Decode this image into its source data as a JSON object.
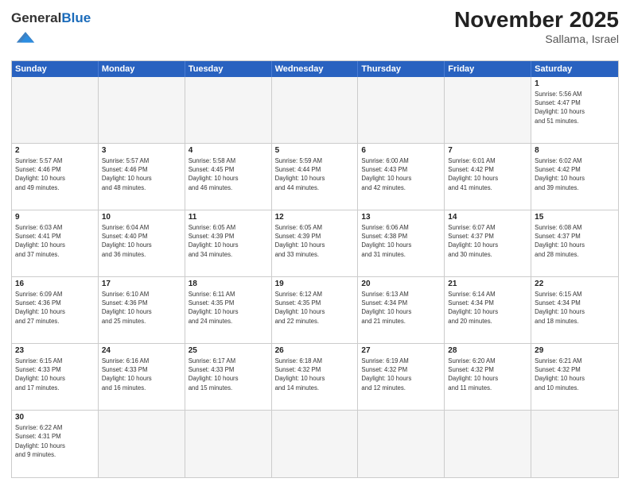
{
  "header": {
    "logo_general": "General",
    "logo_blue": "Blue",
    "month_title": "November 2025",
    "location": "Sallama, Israel"
  },
  "calendar": {
    "days_of_week": [
      "Sunday",
      "Monday",
      "Tuesday",
      "Wednesday",
      "Thursday",
      "Friday",
      "Saturday"
    ],
    "weeks": [
      [
        {
          "day": "",
          "empty": true
        },
        {
          "day": "",
          "empty": true
        },
        {
          "day": "",
          "empty": true
        },
        {
          "day": "",
          "empty": true
        },
        {
          "day": "",
          "empty": true
        },
        {
          "day": "",
          "empty": true
        },
        {
          "day": "1",
          "sunrise": "5:56 AM",
          "sunset": "4:47 PM",
          "daylight": "10 hours and 51 minutes."
        }
      ],
      [
        {
          "day": "2",
          "sunrise": "5:57 AM",
          "sunset": "4:46 PM",
          "daylight": "10 hours and 49 minutes."
        },
        {
          "day": "3",
          "sunrise": "5:57 AM",
          "sunset": "4:46 PM",
          "daylight": "10 hours and 48 minutes."
        },
        {
          "day": "4",
          "sunrise": "5:58 AM",
          "sunset": "4:45 PM",
          "daylight": "10 hours and 46 minutes."
        },
        {
          "day": "5",
          "sunrise": "5:59 AM",
          "sunset": "4:44 PM",
          "daylight": "10 hours and 44 minutes."
        },
        {
          "day": "6",
          "sunrise": "6:00 AM",
          "sunset": "4:43 PM",
          "daylight": "10 hours and 42 minutes."
        },
        {
          "day": "7",
          "sunrise": "6:01 AM",
          "sunset": "4:42 PM",
          "daylight": "10 hours and 41 minutes."
        },
        {
          "day": "8",
          "sunrise": "6:02 AM",
          "sunset": "4:42 PM",
          "daylight": "10 hours and 39 minutes."
        }
      ],
      [
        {
          "day": "9",
          "sunrise": "6:03 AM",
          "sunset": "4:41 PM",
          "daylight": "10 hours and 37 minutes."
        },
        {
          "day": "10",
          "sunrise": "6:04 AM",
          "sunset": "4:40 PM",
          "daylight": "10 hours and 36 minutes."
        },
        {
          "day": "11",
          "sunrise": "6:05 AM",
          "sunset": "4:39 PM",
          "daylight": "10 hours and 34 minutes."
        },
        {
          "day": "12",
          "sunrise": "6:05 AM",
          "sunset": "4:39 PM",
          "daylight": "10 hours and 33 minutes."
        },
        {
          "day": "13",
          "sunrise": "6:06 AM",
          "sunset": "4:38 PM",
          "daylight": "10 hours and 31 minutes."
        },
        {
          "day": "14",
          "sunrise": "6:07 AM",
          "sunset": "4:37 PM",
          "daylight": "10 hours and 30 minutes."
        },
        {
          "day": "15",
          "sunrise": "6:08 AM",
          "sunset": "4:37 PM",
          "daylight": "10 hours and 28 minutes."
        }
      ],
      [
        {
          "day": "16",
          "sunrise": "6:09 AM",
          "sunset": "4:36 PM",
          "daylight": "10 hours and 27 minutes."
        },
        {
          "day": "17",
          "sunrise": "6:10 AM",
          "sunset": "4:36 PM",
          "daylight": "10 hours and 25 minutes."
        },
        {
          "day": "18",
          "sunrise": "6:11 AM",
          "sunset": "4:35 PM",
          "daylight": "10 hours and 24 minutes."
        },
        {
          "day": "19",
          "sunrise": "6:12 AM",
          "sunset": "4:35 PM",
          "daylight": "10 hours and 22 minutes."
        },
        {
          "day": "20",
          "sunrise": "6:13 AM",
          "sunset": "4:34 PM",
          "daylight": "10 hours and 21 minutes."
        },
        {
          "day": "21",
          "sunrise": "6:14 AM",
          "sunset": "4:34 PM",
          "daylight": "10 hours and 20 minutes."
        },
        {
          "day": "22",
          "sunrise": "6:15 AM",
          "sunset": "4:34 PM",
          "daylight": "10 hours and 18 minutes."
        }
      ],
      [
        {
          "day": "23",
          "sunrise": "6:15 AM",
          "sunset": "4:33 PM",
          "daylight": "10 hours and 17 minutes."
        },
        {
          "day": "24",
          "sunrise": "6:16 AM",
          "sunset": "4:33 PM",
          "daylight": "10 hours and 16 minutes."
        },
        {
          "day": "25",
          "sunrise": "6:17 AM",
          "sunset": "4:33 PM",
          "daylight": "10 hours and 15 minutes."
        },
        {
          "day": "26",
          "sunrise": "6:18 AM",
          "sunset": "4:32 PM",
          "daylight": "10 hours and 14 minutes."
        },
        {
          "day": "27",
          "sunrise": "6:19 AM",
          "sunset": "4:32 PM",
          "daylight": "10 hours and 12 minutes."
        },
        {
          "day": "28",
          "sunrise": "6:20 AM",
          "sunset": "4:32 PM",
          "daylight": "10 hours and 11 minutes."
        },
        {
          "day": "29",
          "sunrise": "6:21 AM",
          "sunset": "4:32 PM",
          "daylight": "10 hours and 10 minutes."
        }
      ],
      [
        {
          "day": "30",
          "sunrise": "6:22 AM",
          "sunset": "4:31 PM",
          "daylight": "10 hours and 9 minutes."
        },
        {
          "day": "",
          "empty": true
        },
        {
          "day": "",
          "empty": true
        },
        {
          "day": "",
          "empty": true
        },
        {
          "day": "",
          "empty": true
        },
        {
          "day": "",
          "empty": true
        },
        {
          "day": "",
          "empty": true
        }
      ]
    ]
  }
}
